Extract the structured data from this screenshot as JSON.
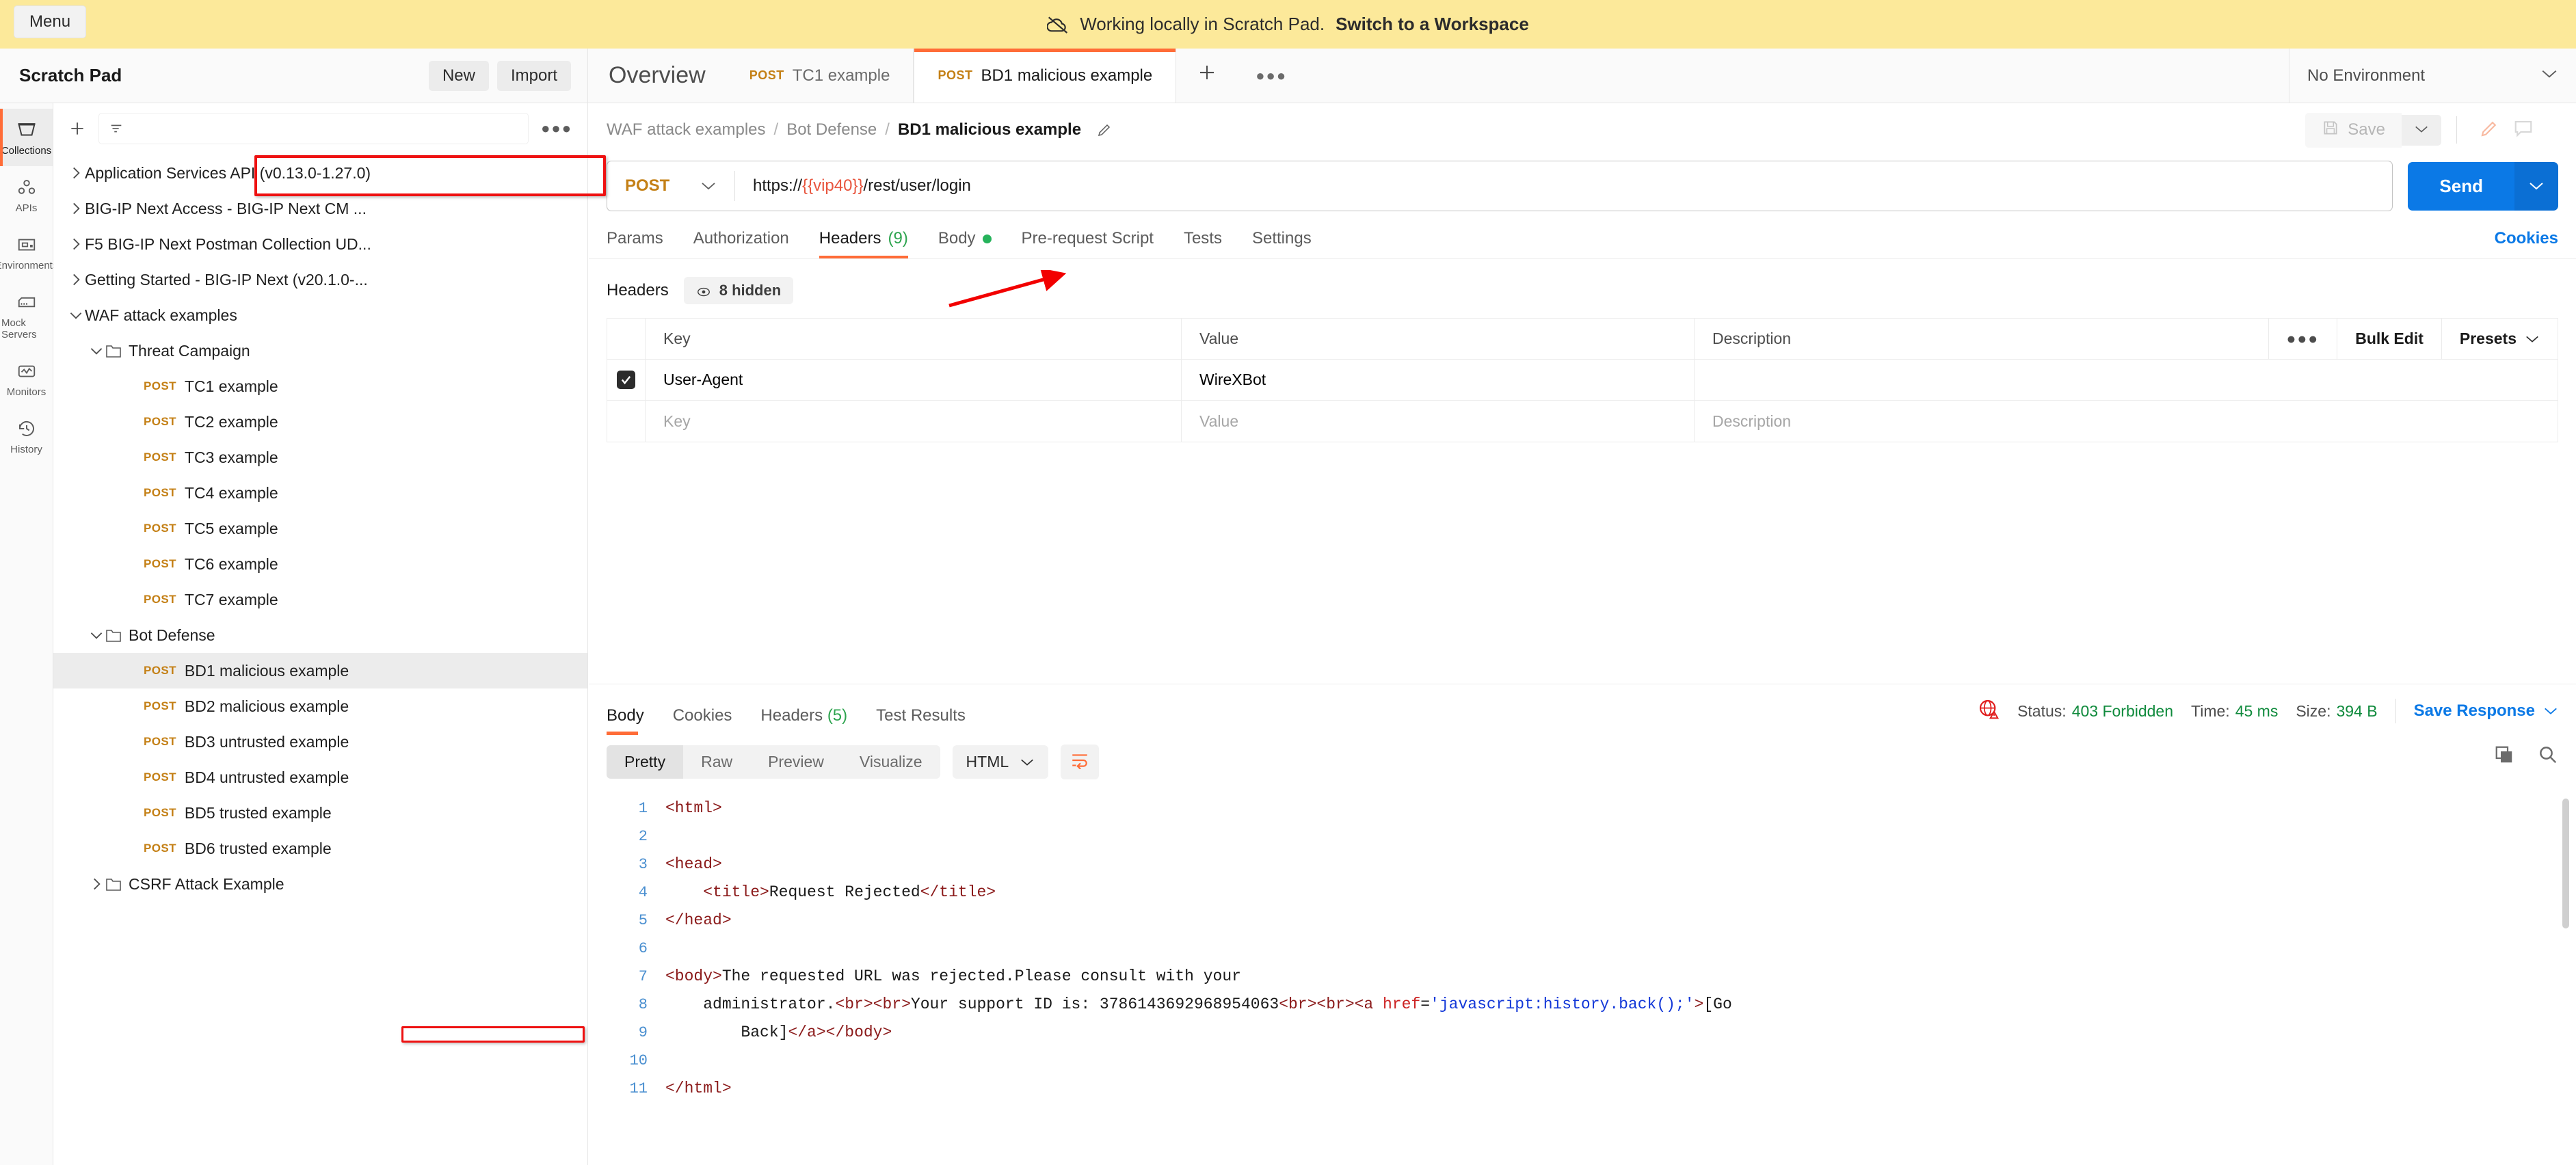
{
  "banner": {
    "menu_label": "Menu",
    "text": "Working locally in Scratch Pad.",
    "link": "Switch to a Workspace",
    "icon": "cloud-offline-icon"
  },
  "header": {
    "workspace_title": "Scratch Pad",
    "new_label": "New",
    "import_label": "Import",
    "environment": "No Environment",
    "tabs": [
      {
        "label": "Overview",
        "method": "",
        "active": false
      },
      {
        "label": "TC1 example",
        "method": "POST",
        "active": false
      },
      {
        "label": "BD1 malicious example",
        "method": "POST",
        "active": true
      }
    ],
    "add_tab_icon": "plus-icon",
    "tab_overflow_icon": "ellipsis-icon"
  },
  "rail": {
    "items": [
      {
        "label": "Collections",
        "icon": "collections-icon",
        "active": true
      },
      {
        "label": "APIs",
        "icon": "apis-icon",
        "active": false
      },
      {
        "label": "Environments",
        "icon": "environments-icon",
        "active": false
      },
      {
        "label": "Mock Servers",
        "icon": "mock-servers-icon",
        "active": false
      },
      {
        "label": "Monitors",
        "icon": "monitors-icon",
        "active": false
      },
      {
        "label": "History",
        "icon": "history-icon",
        "active": false
      }
    ]
  },
  "sidebar": {
    "new_icon": "plus-icon",
    "filter_icon": "filter-icon",
    "filter_placeholder": "",
    "more_icon": "ellipsis-icon",
    "tree": [
      {
        "label": "Application Services API (v0.13.0-1.27.0)",
        "type": "collection",
        "indent": 0,
        "expanded": false
      },
      {
        "label": "BIG-IP Next Access - BIG-IP Next CM ...",
        "type": "collection",
        "indent": 0,
        "expanded": false
      },
      {
        "label": "F5 BIG-IP Next Postman Collection UD...",
        "type": "collection",
        "indent": 0,
        "expanded": false
      },
      {
        "label": "Getting Started - BIG-IP Next (v20.1.0-...",
        "type": "collection",
        "indent": 0,
        "expanded": false
      },
      {
        "label": "WAF attack examples",
        "type": "collection",
        "indent": 0,
        "expanded": true
      },
      {
        "label": "Threat Campaign",
        "type": "folder",
        "indent": 1,
        "expanded": true
      },
      {
        "label": "TC1 example",
        "type": "request",
        "method": "POST",
        "indent": 2
      },
      {
        "label": "TC2 example",
        "type": "request",
        "method": "POST",
        "indent": 2
      },
      {
        "label": "TC3 example",
        "type": "request",
        "method": "POST",
        "indent": 2
      },
      {
        "label": "TC4 example",
        "type": "request",
        "method": "POST",
        "indent": 2
      },
      {
        "label": "TC5 example",
        "type": "request",
        "method": "POST",
        "indent": 2
      },
      {
        "label": "TC6 example",
        "type": "request",
        "method": "POST",
        "indent": 2
      },
      {
        "label": "TC7 example",
        "type": "request",
        "method": "POST",
        "indent": 2
      },
      {
        "label": "Bot Defense",
        "type": "folder",
        "indent": 1,
        "expanded": true
      },
      {
        "label": "BD1 malicious example",
        "type": "request",
        "method": "POST",
        "indent": 2,
        "selected": true
      },
      {
        "label": "BD2 malicious example",
        "type": "request",
        "method": "POST",
        "indent": 2
      },
      {
        "label": "BD3 untrusted example",
        "type": "request",
        "method": "POST",
        "indent": 2
      },
      {
        "label": "BD4 untrusted example",
        "type": "request",
        "method": "POST",
        "indent": 2
      },
      {
        "label": "BD5 trusted example",
        "type": "request",
        "method": "POST",
        "indent": 2
      },
      {
        "label": "BD6 trusted example",
        "type": "request",
        "method": "POST",
        "indent": 2
      },
      {
        "label": "CSRF Attack Example",
        "type": "folder",
        "indent": 1,
        "expanded": false
      }
    ]
  },
  "request": {
    "breadcrumb": {
      "collection": "WAF attack examples",
      "folder": "Bot Defense",
      "name": "BD1 malicious example",
      "separator": "/",
      "edit_icon": "pencil-icon"
    },
    "save_label": "Save",
    "save_icon": "floppy-disk-icon",
    "save_caret_icon": "chevron-down-icon",
    "edit_icon": "pencil-icon",
    "comment_icon": "comment-icon",
    "method": "POST",
    "url_prefix": "https://",
    "url_variable": "{{vip40}}",
    "url_suffix": "/rest/user/login",
    "send_label": "Send",
    "send_caret_icon": "chevron-down-icon",
    "tabs": [
      {
        "label": "Params",
        "active": false
      },
      {
        "label": "Authorization",
        "active": false
      },
      {
        "label": "Headers",
        "count": "(9)",
        "active": true
      },
      {
        "label": "Body",
        "dot": true,
        "active": false
      },
      {
        "label": "Pre-request Script",
        "active": false
      },
      {
        "label": "Tests",
        "active": false
      },
      {
        "label": "Settings",
        "active": false
      }
    ],
    "cookies_link": "Cookies",
    "headers_label": "Headers",
    "hidden_pill": "8 hidden",
    "hidden_icon": "eye-off-icon",
    "table": {
      "columns": [
        "Key",
        "Value",
        "Description"
      ],
      "actions": {
        "more_icon": "ellipsis-icon",
        "bulk_edit": "Bulk Edit",
        "presets": "Presets",
        "presets_caret": "chevron-down-icon"
      },
      "rows": [
        {
          "checked": true,
          "key": "User-Agent",
          "value": "WireXBot",
          "description": ""
        }
      ],
      "placeholder_row": {
        "key": "Key",
        "value": "Value",
        "description": "Description"
      }
    }
  },
  "response": {
    "tabs": [
      {
        "label": "Body",
        "active": true
      },
      {
        "label": "Cookies",
        "active": false
      },
      {
        "label": "Headers",
        "count": "(5)",
        "active": false
      },
      {
        "label": "Test Results",
        "active": false
      }
    ],
    "warning_icon": "globe-warning-icon",
    "status_label": "Status:",
    "status_value": "403 Forbidden",
    "time_label": "Time:",
    "time_value": "45 ms",
    "size_label": "Size:",
    "size_value": "394 B",
    "save_response": "Save Response",
    "save_response_caret": "chevron-down-icon",
    "format_tabs": [
      {
        "label": "Pretty",
        "active": true
      },
      {
        "label": "Raw",
        "active": false
      },
      {
        "label": "Preview",
        "active": false
      },
      {
        "label": "Visualize",
        "active": false
      }
    ],
    "language": "HTML",
    "language_caret": "chevron-down-icon",
    "wrap_icon": "word-wrap-icon",
    "copy_icon": "copy-icon",
    "search_icon": "search-icon",
    "body_lines": [
      {
        "n": "1",
        "segments": [
          {
            "t": "<html>",
            "c": "tg"
          }
        ]
      },
      {
        "n": "2",
        "segments": []
      },
      {
        "n": "3",
        "segments": [
          {
            "t": "<head>",
            "c": "tg"
          }
        ]
      },
      {
        "n": "4",
        "segments": [
          {
            "t": "    ",
            "c": ""
          },
          {
            "t": "<title>",
            "c": "tg"
          },
          {
            "t": "Request Rejected",
            "c": ""
          },
          {
            "t": "</title>",
            "c": "tg"
          }
        ]
      },
      {
        "n": "5",
        "segments": [
          {
            "t": "</head>",
            "c": "tg"
          }
        ]
      },
      {
        "n": "6",
        "segments": []
      },
      {
        "n": "7",
        "segments": [
          {
            "t": "<body>",
            "c": "tg"
          },
          {
            "t": "The requested URL was rejected.Please consult with your",
            "c": ""
          }
        ]
      },
      {
        "n": "8",
        "segments": [
          {
            "t": "    administrator.",
            "c": ""
          },
          {
            "t": "<br>",
            "c": "tg"
          },
          {
            "t": "<br>",
            "c": "tg"
          },
          {
            "t": "Your support ID is: 3786143692968954063",
            "c": ""
          },
          {
            "t": "<br>",
            "c": "tg"
          },
          {
            "t": "<br>",
            "c": "tg"
          },
          {
            "t": "<a ",
            "c": "tg"
          },
          {
            "t": "href",
            "c": "at"
          },
          {
            "t": "=",
            "c": ""
          },
          {
            "t": "'javascript:history.back();'",
            "c": "st"
          },
          {
            "t": ">",
            "c": "tg"
          },
          {
            "t": "[Go",
            "c": ""
          }
        ]
      },
      {
        "n": "9",
        "segments": [
          {
            "t": "        Back]",
            "c": ""
          },
          {
            "t": "</a>",
            "c": "tg"
          },
          {
            "t": "</body>",
            "c": "tg"
          }
        ]
      },
      {
        "n": "10",
        "segments": []
      },
      {
        "n": "11",
        "segments": [
          {
            "t": "</html>",
            "c": "tg"
          }
        ]
      }
    ],
    "support_id": "3786143692968954063"
  },
  "annotations": {
    "header_row_box": "red-highlight-box",
    "support_id_box": "red-highlight-box",
    "cookies_arrow": "red-arrow"
  },
  "colors": {
    "accent": "#ff6c37",
    "banner": "#fce99a",
    "link": "#0b79e6",
    "method": "#c48016",
    "success": "#0f8a3c",
    "annotation": "#ee1111"
  }
}
